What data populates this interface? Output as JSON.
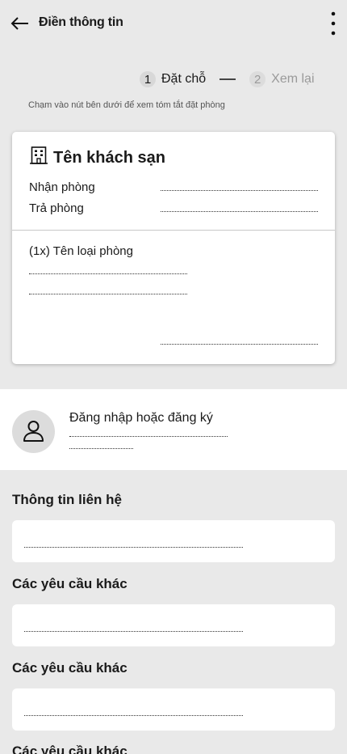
{
  "header": {
    "title": "Điền thông tin",
    "back_icon": "arrow-left-icon",
    "more_icon": "more-vertical-icon"
  },
  "stepper": {
    "steps": [
      {
        "number": "1",
        "label": "Đặt chỗ",
        "active": true
      },
      {
        "number": "2",
        "label": "Xem lại",
        "active": false
      }
    ]
  },
  "hint": "Chạm vào nút bên dưới để xem tóm tắt đặt phòng",
  "booking": {
    "hotel_icon": "hotel-building-icon",
    "hotel_name": "Tên khách sạn",
    "check_in_label": "Nhận phòng",
    "check_out_label": "Trả phòng",
    "room_type": "(1x) Tên loại phòng"
  },
  "login": {
    "avatar_icon": "user-icon",
    "label": "Đăng nhập hoặc đăng ký"
  },
  "sections": [
    {
      "title": "Thông tin liên hệ"
    },
    {
      "title": "Các yêu cầu khác"
    },
    {
      "title": "Các yêu cầu khác"
    },
    {
      "title": "Các yêu cầu khác"
    }
  ]
}
